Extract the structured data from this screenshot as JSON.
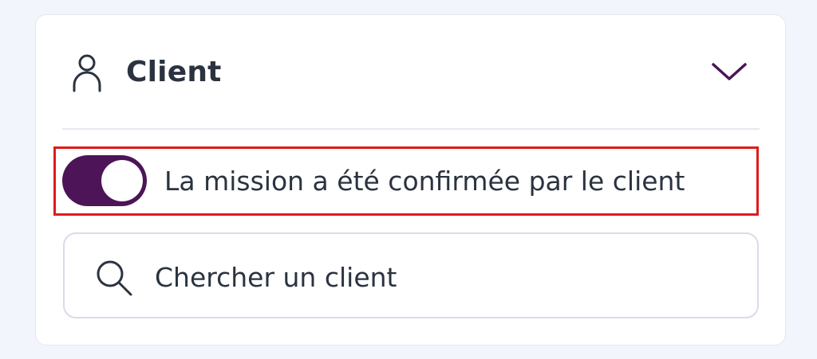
{
  "client_section": {
    "title": "Client",
    "icons": {
      "header_icon": "user-icon",
      "collapse_icon": "chevron-down-icon",
      "search_icon": "search-icon"
    },
    "mission_confirmed_toggle": {
      "label": "La mission a été confirmée par le client",
      "checked": true,
      "color": "#4d1457"
    },
    "search": {
      "placeholder": "Chercher un client",
      "value": ""
    },
    "highlight_color": "#e01b1b"
  }
}
